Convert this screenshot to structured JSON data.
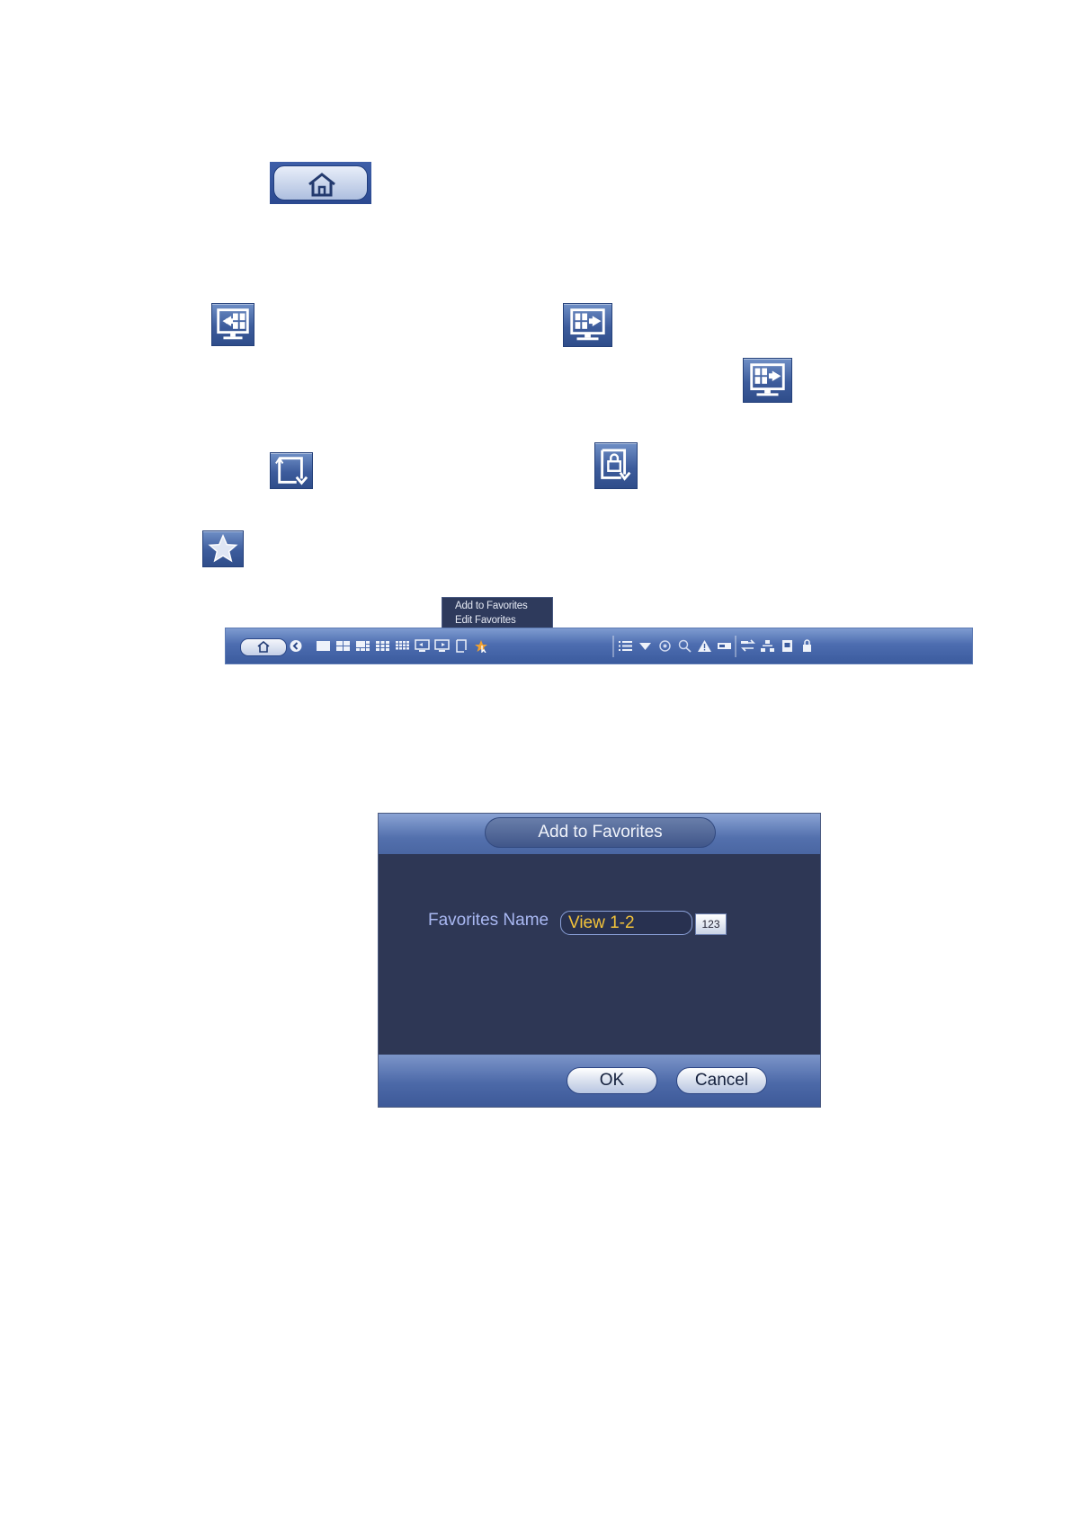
{
  "icons": {
    "home_button": "home-icon",
    "prev_screen": "previous-screen-icon",
    "next_screen": "next-screen-icon",
    "next_screen_alt": "next-screen-icon",
    "rotate": "rotate-icon",
    "lock": "lock-icon",
    "favorites": "star-icon"
  },
  "context_menu": {
    "items": [
      "Add to Favorites",
      "Edit Favorites"
    ]
  },
  "dialog": {
    "title": "Add to Favorites",
    "favorites_name_label": "Favorites Name",
    "favorites_name_value": "View 1-2",
    "keyboard_button": "123",
    "ok_label": "OK",
    "cancel_label": "Cancel"
  },
  "colors": {
    "panel_blue": "#3d5c9c",
    "dialog_body": "#2e3755",
    "label_text": "#a9b8f2",
    "input_text": "#f3c33a"
  }
}
